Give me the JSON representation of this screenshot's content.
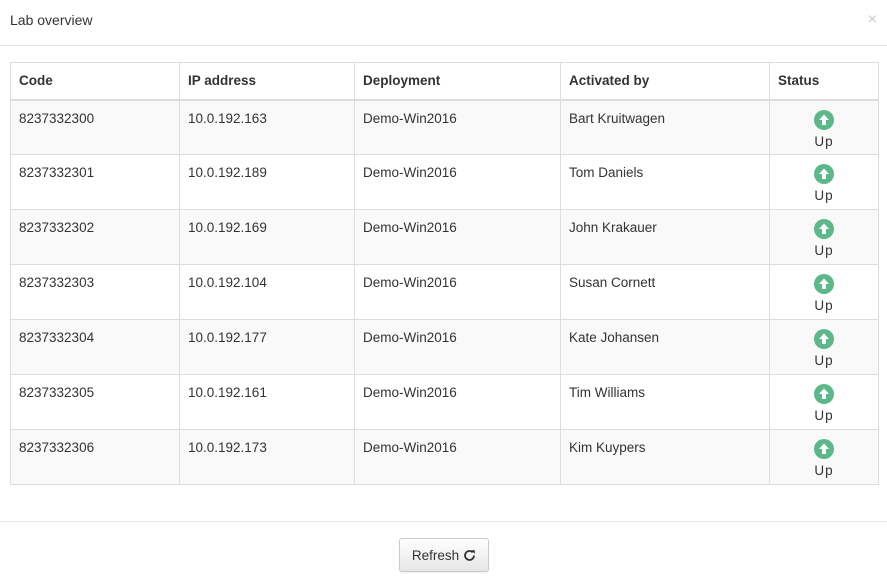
{
  "modal": {
    "title": "Lab overview",
    "close_glyph": "×",
    "close_icon": "close-icon"
  },
  "table": {
    "headers": [
      "Code",
      "IP address",
      "Deployment",
      "Activated by",
      "Status"
    ],
    "rows": [
      {
        "code": "8237332300",
        "ip": "10.0.192.163",
        "deployment": "Demo-Win2016",
        "activated_by": "Bart Kruitwagen",
        "status": "Up",
        "status_icon": "arrow-up-circle-icon"
      },
      {
        "code": "8237332301",
        "ip": "10.0.192.189",
        "deployment": "Demo-Win2016",
        "activated_by": "Tom Daniels",
        "status": "Up",
        "status_icon": "arrow-up-circle-icon"
      },
      {
        "code": "8237332302",
        "ip": "10.0.192.169",
        "deployment": "Demo-Win2016",
        "activated_by": "John Krakauer",
        "status": "Up",
        "status_icon": "arrow-up-circle-icon"
      },
      {
        "code": "8237332303",
        "ip": "10.0.192.104",
        "deployment": "Demo-Win2016",
        "activated_by": "Susan Cornett",
        "status": "Up",
        "status_icon": "arrow-up-circle-icon"
      },
      {
        "code": "8237332304",
        "ip": "10.0.192.177",
        "deployment": "Demo-Win2016",
        "activated_by": "Kate Johansen",
        "status": "Up",
        "status_icon": "arrow-up-circle-icon"
      },
      {
        "code": "8237332305",
        "ip": "10.0.192.161",
        "deployment": "Demo-Win2016",
        "activated_by": "Tim Williams",
        "status": "Up",
        "status_icon": "arrow-up-circle-icon"
      },
      {
        "code": "8237332306",
        "ip": "10.0.192.173",
        "deployment": "Demo-Win2016",
        "activated_by": "Kim Kuypers",
        "status": "Up",
        "status_icon": "arrow-up-circle-icon"
      }
    ]
  },
  "footer": {
    "refresh_label": "Refresh",
    "refresh_icon": "refresh-icon"
  },
  "colors": {
    "status_up": "#5cb88a",
    "border": "#dddddd",
    "stripe": "#f9f9f9"
  }
}
